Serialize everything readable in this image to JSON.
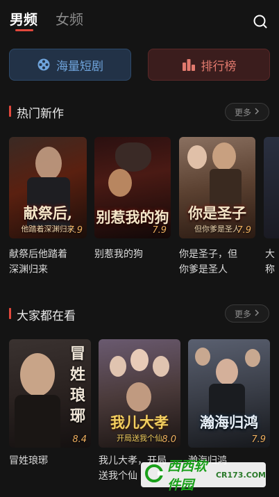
{
  "tabs": [
    {
      "label": "男频",
      "active": true
    },
    {
      "label": "女频",
      "active": false
    }
  ],
  "header": {
    "search_icon": "search-icon"
  },
  "categories": [
    {
      "label": "海量短剧",
      "icon": "film-reel-icon",
      "color": "#6fa4dc"
    },
    {
      "label": "排行榜",
      "icon": "bar-chart-icon",
      "color": "#e27a6e"
    }
  ],
  "sections": [
    {
      "title": "热门新作",
      "more": "更多",
      "items": [
        {
          "poster_title": "献祭后,",
          "poster_sub": "他踏着深渊归来",
          "score": "7.9",
          "caption": "献祭后他踏着深渊归来",
          "caption_lines": [
            "献祭后他踏着",
            "深渊归来"
          ]
        },
        {
          "poster_title": "别惹我的狗",
          "poster_sub": "",
          "score": "7.9",
          "caption": "别惹我的狗",
          "caption_lines": [
            "别惹我的狗",
            ""
          ]
        },
        {
          "poster_title": "你是圣子",
          "poster_sub": "但你爹是圣人",
          "score": "7.9",
          "caption": "你是圣子，但你爹是圣人",
          "caption_lines": [
            "你是圣子，但",
            "你爹是圣人"
          ]
        },
        {
          "poster_title": "",
          "poster_sub": "",
          "score": "",
          "caption": "大...称...",
          "caption_lines": [
            "大",
            "称"
          ]
        }
      ]
    },
    {
      "title": "大家都在看",
      "more": "更多",
      "items": [
        {
          "poster_title": "冒姓琅琊",
          "poster_sub": "",
          "score": "8.4",
          "caption": "冒姓琅琊",
          "caption_lines": [
            "冒姓琅琊",
            ""
          ]
        },
        {
          "poster_title": "我儿大孝",
          "poster_sub": "开局送我个仙",
          "score": "8.0",
          "caption": "我儿大孝，开局送我个仙",
          "caption_lines": [
            "我儿大孝，开局",
            "送我个仙"
          ]
        },
        {
          "poster_title": "瀚海归鸿",
          "poster_sub": "",
          "score": "7.9",
          "caption": "瀚海归鸿",
          "caption_lines": [
            "瀚海归鸿",
            ""
          ]
        }
      ]
    }
  ],
  "watermark": {
    "brand": "西西软件园",
    "url": "CR173.COM"
  }
}
